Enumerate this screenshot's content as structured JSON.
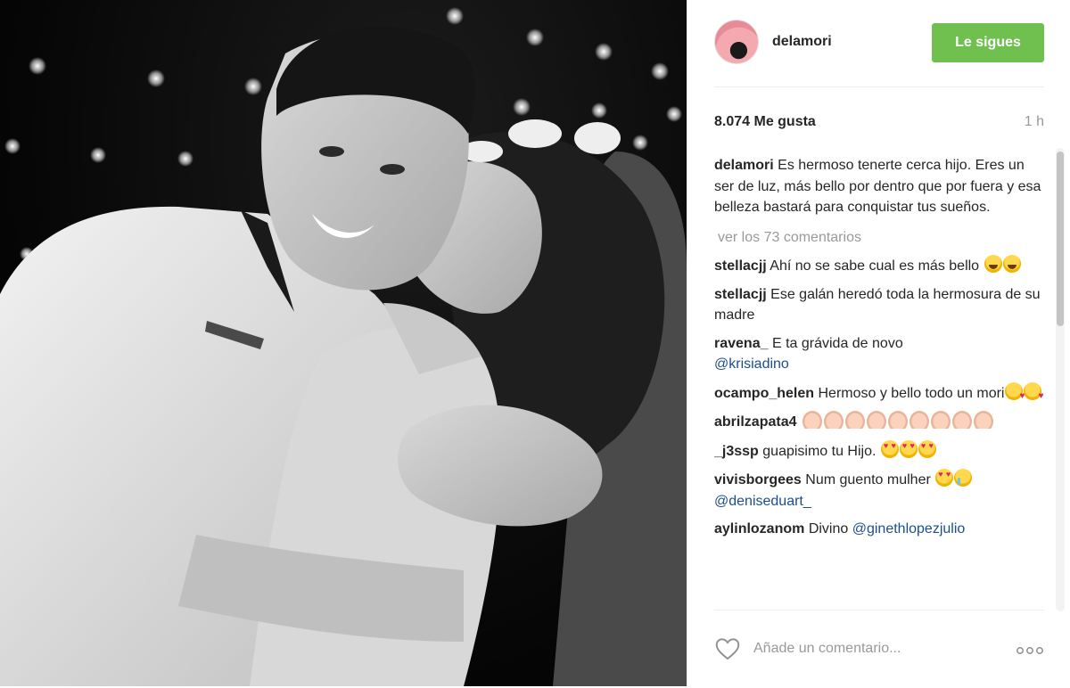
{
  "post": {
    "username": "delamori",
    "follow_label": "Le sigues",
    "likes": "8.074 Me gusta",
    "time": "1 h",
    "caption_text": "Es hermoso tenerte cerca hijo. Eres un ser de luz, más bello por dentro que por fuera y esa belleza bastará para conquistar tus sueños.",
    "view_all": "ver los 73 comentarios"
  },
  "comments": [
    {
      "user": "stellacjj",
      "text": "Ahí no se sabe cual es más bello",
      "mention": ""
    },
    {
      "user": "stellacjj",
      "text": "Ese galán heredó toda la hermosura de su madre",
      "mention": ""
    },
    {
      "user": "ravena_",
      "text": "E ta grávida de novo",
      "mention": "@krisiadino"
    },
    {
      "user": "ocampo_helen",
      "text": "Hermoso y bello todo un mori",
      "mention": ""
    },
    {
      "user": "abrilzapata4",
      "text": "",
      "mention": ""
    },
    {
      "user": "_j3ssp",
      "text": "guapisimo tu Hijo.",
      "mention": ""
    },
    {
      "user": "vivisborgees",
      "text": "Num guento mulher",
      "mention": "@deniseduart_"
    },
    {
      "user": "aylinlozanom",
      "text": "Divino",
      "mention": "@ginethlopezjulio"
    }
  ],
  "footer": {
    "comment_placeholder": "Añade un comentario...",
    "more_label": "ooo"
  },
  "icons": {
    "like": "heart-outline-icon",
    "more": "ellipsis-icon"
  },
  "colors": {
    "follow_button": "#70c050",
    "mention": "#1c4e8a",
    "muted": "#999999"
  }
}
